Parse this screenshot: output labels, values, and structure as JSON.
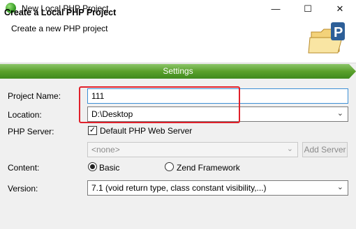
{
  "window": {
    "title": "New Local PHP Project",
    "controls": {
      "minimize": "—",
      "maximize": "☐",
      "close": "✕"
    }
  },
  "header": {
    "title": "Create a Local PHP Project",
    "subtitle": "Create a new PHP project",
    "icon": "folder-php-icon"
  },
  "section": {
    "label": "Settings",
    "accent": "#5aa02c"
  },
  "form": {
    "project_name": {
      "label": "Project Name:",
      "value": "111"
    },
    "location": {
      "label": "Location:",
      "value": "D:\\Desktop"
    },
    "php_server": {
      "label": "PHP Server:",
      "checkbox_label": "Default PHP Web Server",
      "checked": true,
      "select_value": "<none>",
      "add_button": "Add Server"
    },
    "content": {
      "label": "Content:",
      "options": [
        "Basic",
        "Zend Framework"
      ],
      "selected": "Basic"
    },
    "version": {
      "label": "Version:",
      "value": "7.1 (void return type, class constant visibility,...)"
    }
  },
  "colors": {
    "highlight": "#e0202a",
    "accent_green": "#5aa02c",
    "focus_border": "#3c8fd6"
  }
}
